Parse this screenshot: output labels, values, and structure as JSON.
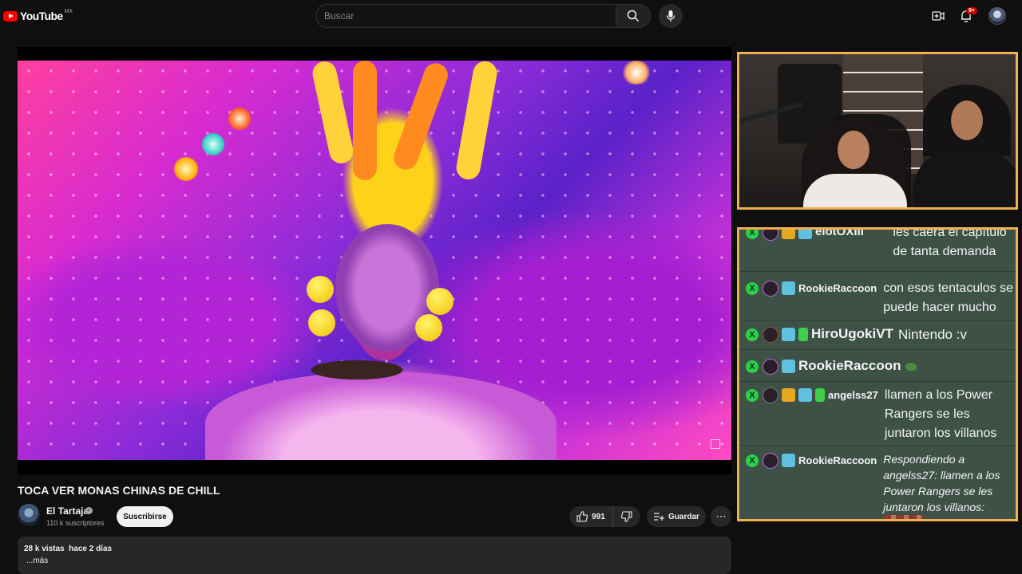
{
  "header": {
    "logo_text": "YouTube",
    "region": "MX",
    "search_placeholder": "Buscar",
    "notification_count": "9+"
  },
  "video": {
    "title": "TOCA VER MONAS CHINAS DE CHILL",
    "channel_name": "El Tartaja",
    "subscribers": "110 k suscriptores",
    "subscribe_label": "Suscribirse",
    "likes": "991",
    "save_label": "Guardar",
    "more_label": "⋯",
    "views_date": "28 k vistas  hace 2 días",
    "desc_more": "...más"
  },
  "chat": {
    "messages": [
      {
        "user": "elotOXIII",
        "text": "les caerá el capítulo de tanta demanda"
      },
      {
        "user": "RookieRaccoon",
        "text": "con esos tentaculos se puede hacer mucho"
      },
      {
        "user": "HiroUgokiVT",
        "text": "Nintendo :v"
      },
      {
        "user": "RookieRaccoon",
        "text": ""
      },
      {
        "user": "angelss27",
        "text": "llamen a los Power Rangers se les juntaron los villanos"
      },
      {
        "user": "RookieRaccoon",
        "text": "Respondiendo a angelss27: llamen a los Power Rangers se les juntaron los villanos:"
      }
    ]
  },
  "colors": {
    "background": "#0f0f0f",
    "frame_border": "#f0b050",
    "chat_bg": "#3e5147",
    "mod_badge": "#2bd04b"
  }
}
